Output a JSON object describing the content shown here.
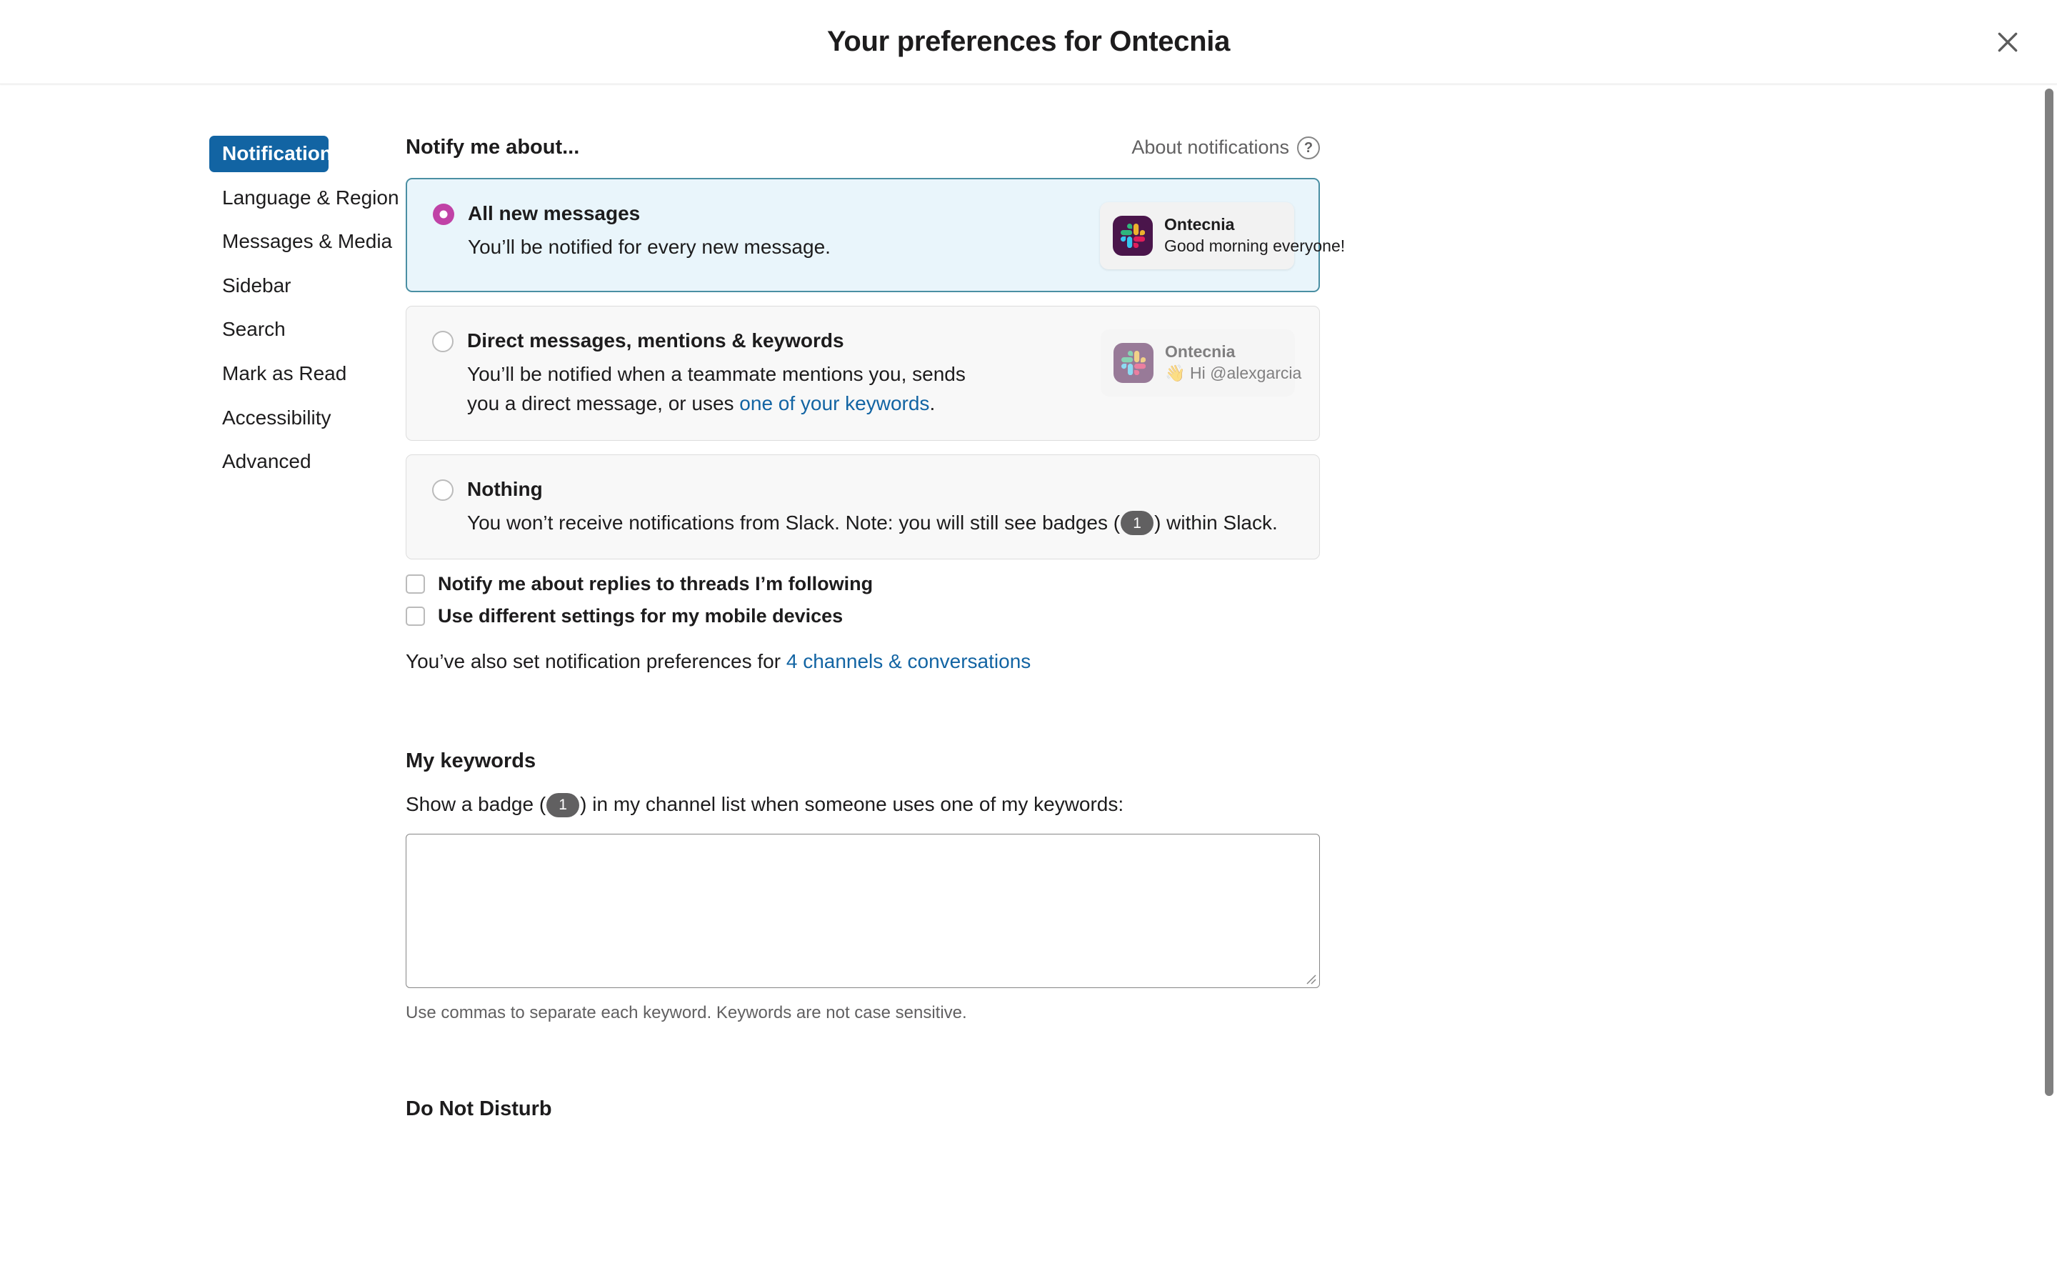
{
  "header": {
    "title": "Your preferences for Ontecnia",
    "close_icon": "close-icon"
  },
  "sidebar": {
    "items": [
      {
        "label": "Notifications",
        "active": true
      },
      {
        "label": "Language & Region",
        "active": false
      },
      {
        "label": "Messages & Media",
        "active": false
      },
      {
        "label": "Sidebar",
        "active": false
      },
      {
        "label": "Search",
        "active": false
      },
      {
        "label": "Mark as Read",
        "active": false
      },
      {
        "label": "Accessibility",
        "active": false
      },
      {
        "label": "Advanced",
        "active": false
      }
    ]
  },
  "notify": {
    "section_title": "Notify me about...",
    "about_link": "About notifications",
    "help_icon": "?",
    "options": [
      {
        "label": "All new messages",
        "description": "You’ll be notified for every new message.",
        "selected": true,
        "preview": {
          "app": "Ontecnia",
          "message": "Good morning everyone!",
          "muted": false
        }
      },
      {
        "label": "Direct messages, mentions & keywords",
        "description_part1": "You’ll be notified when a teammate mentions you, sends you a direct message, or uses ",
        "description_link": "one of your keywords",
        "description_part2": ".",
        "selected": false,
        "preview": {
          "app": "Ontecnia",
          "message": "👋 Hi @alexgarcia",
          "muted": true
        }
      },
      {
        "label": "Nothing",
        "description_part1": "You won’t receive notifications from Slack. Note: you will still see badges (",
        "badge": "1",
        "description_part2": ") within Slack.",
        "selected": false
      }
    ],
    "checkboxes": [
      {
        "label": "Notify me about replies to threads I’m following",
        "checked": false
      },
      {
        "label": "Use different settings for my mobile devices",
        "checked": false
      }
    ],
    "footnote_prefix": "You’ve also set notification preferences for ",
    "footnote_link": "4 channels & conversations"
  },
  "keywords": {
    "title": "My keywords",
    "prompt_prefix": "Show a badge (",
    "prompt_badge": "1",
    "prompt_suffix": ") in my channel list when someone uses one of my keywords:",
    "value": "",
    "placeholder": "",
    "help": "Use commas to separate each keyword. Keywords are not case sensitive."
  },
  "do_not_disturb": {
    "title": "Do Not Disturb"
  },
  "colors": {
    "accent_blue": "#1264a3",
    "selected_card_bg": "#e9f5fb",
    "selected_card_border": "#4a8fa3",
    "radio_selected": "#c042a6",
    "badge_bg": "#616061",
    "slack_purple": "#4a154b",
    "link": "#1264a3"
  }
}
